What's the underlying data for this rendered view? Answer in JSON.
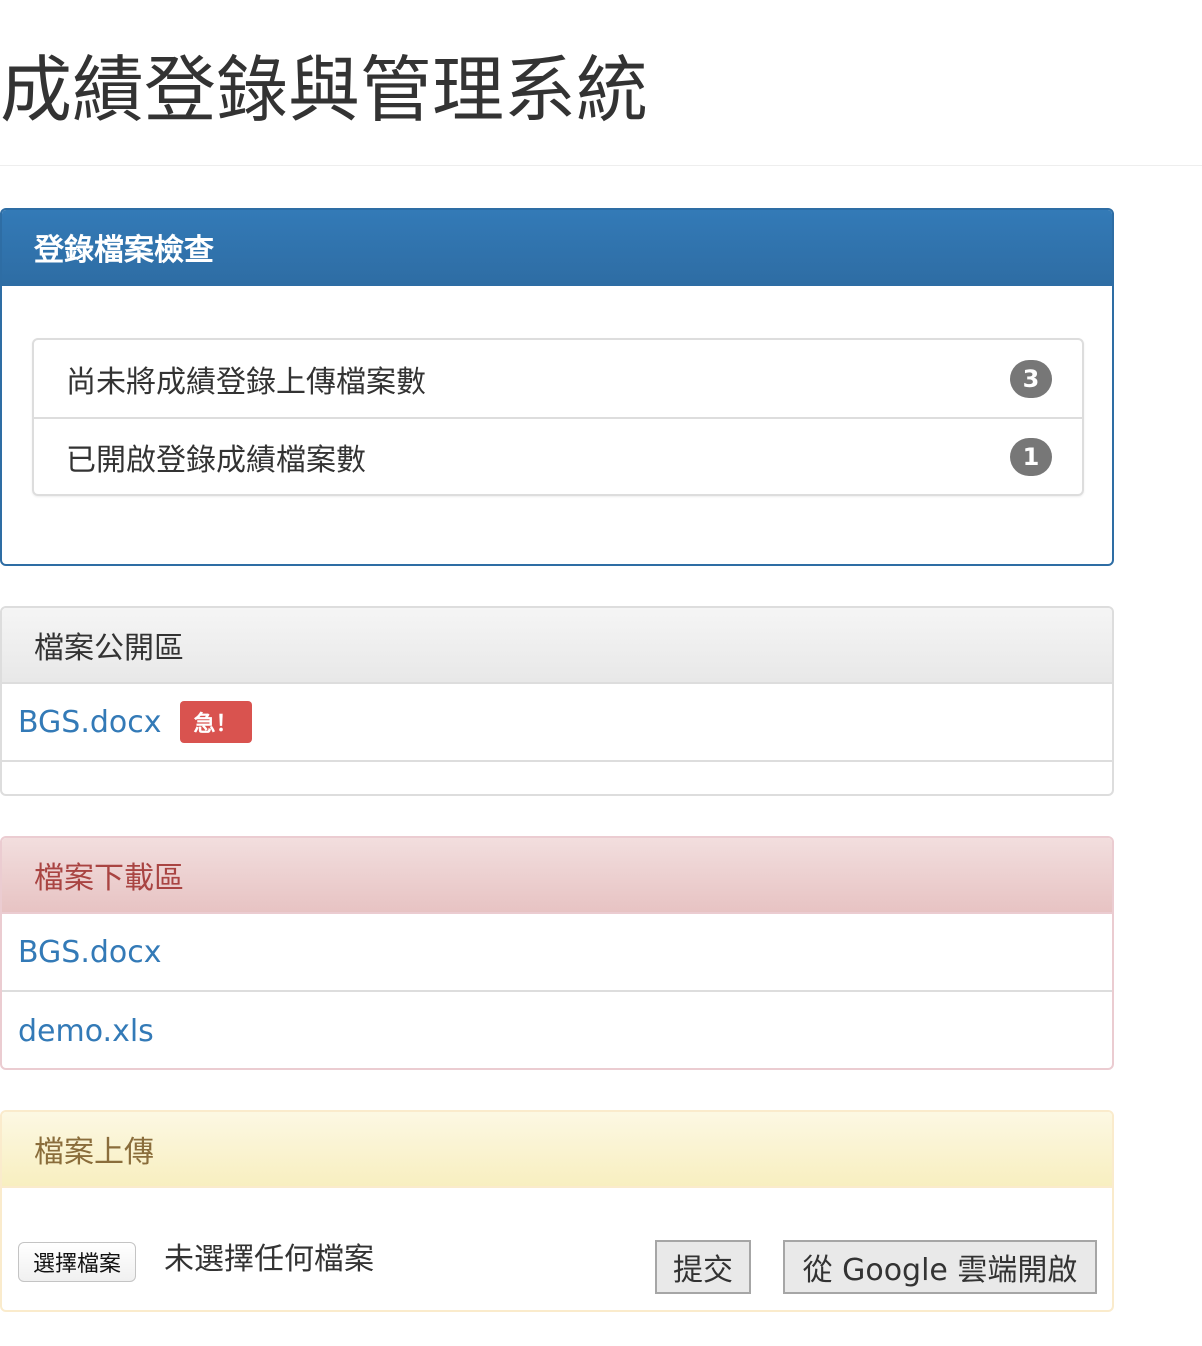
{
  "header": {
    "title": "成績登錄與管理系統"
  },
  "check_panel": {
    "title": "登錄檔案檢查",
    "items": [
      {
        "label": "尚未將成績登錄上傳檔案數",
        "count": "3"
      },
      {
        "label": "已開啟登錄成績檔案數",
        "count": "1"
      }
    ]
  },
  "public_panel": {
    "title": "檔案公開區",
    "files": [
      {
        "name": "BGS.docx",
        "badge": "急！"
      }
    ]
  },
  "download_panel": {
    "title": "檔案下載區",
    "files": [
      {
        "name": "BGS.docx"
      },
      {
        "name": "demo.xls"
      }
    ]
  },
  "upload_panel": {
    "title": "檔案上傳",
    "choose_file_label": "選擇檔案",
    "no_file_text": "未選擇任何檔案",
    "submit_label": "提交",
    "google_label": "從 Google 雲端開啟"
  },
  "colors": {
    "primary": "#337ab7",
    "danger": "#d9534f",
    "badge": "#777777",
    "link": "#337ab7"
  }
}
